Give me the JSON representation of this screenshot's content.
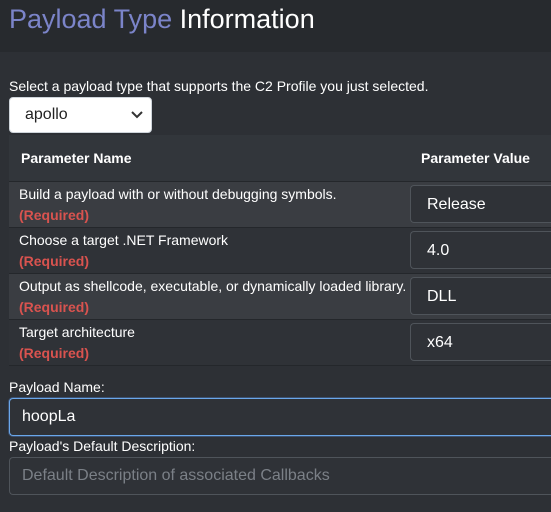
{
  "title": {
    "accent": "Payload Type",
    "rest": "Information"
  },
  "intro_text": "Select a payload type that supports the C2 Profile you just selected.",
  "payload_type_select": {
    "selected": "apollo",
    "icon": "chevron-down-icon"
  },
  "table": {
    "headers": {
      "name": "Parameter Name",
      "value": "Parameter Value"
    },
    "rows": [
      {
        "description": "Build a payload with or without debugging symbols.",
        "required": "(Required)",
        "value": "Release"
      },
      {
        "description": "Choose a target .NET Framework",
        "required": "(Required)",
        "value": "4.0"
      },
      {
        "description": "Output as shellcode, executable, or dynamically loaded library.",
        "required": "(Required)",
        "value": "DLL"
      },
      {
        "description": "Target architecture",
        "required": "(Required)",
        "value": "x64"
      }
    ]
  },
  "payload_name": {
    "label": "Payload Name:",
    "value": "hoopLa"
  },
  "default_description": {
    "label": "Payload's Default Description:",
    "placeholder": "Default Description of associated Callbacks"
  },
  "colors": {
    "accent": "#7b84c9",
    "required": "#d9534f",
    "focus_border": "#6aa7ea"
  }
}
